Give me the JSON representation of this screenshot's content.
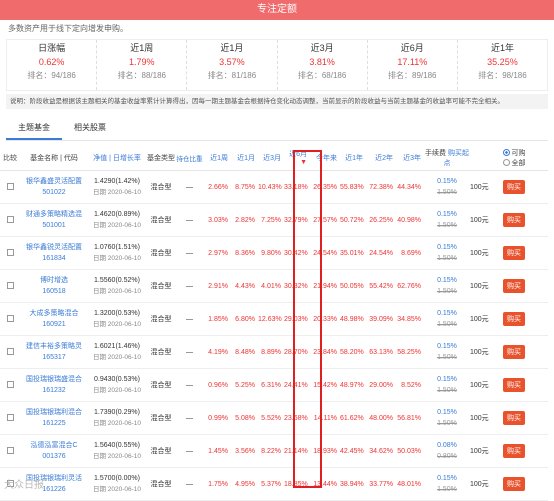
{
  "header": {
    "title": "专注定额"
  },
  "notice": "多数资产用于线下定向增发申购。",
  "stats": [
    {
      "label": "日涨幅",
      "pct": "0.62%",
      "rank": "排名：94/186"
    },
    {
      "label": "近1周",
      "pct": "1.79%",
      "rank": "排名：88/186"
    },
    {
      "label": "近1月",
      "pct": "3.57%",
      "rank": "排名：81/186"
    },
    {
      "label": "近3月",
      "pct": "3.81%",
      "rank": "排名：68/186"
    },
    {
      "label": "近6月",
      "pct": "17.11%",
      "rank": "排名：89/186"
    },
    {
      "label": "近1年",
      "pct": "35.25%",
      "rank": "排名：98/186"
    }
  ],
  "explain": "说明：阶段收益是根据该主题相关的基金收益率累计计算得出，因每一期主题基金会根据持仓变化动态调整，当前显示的阶段收益与当前主题基金的收益率可能不完全相关。",
  "tabs": [
    {
      "label": "主题基金"
    },
    {
      "label": "相关股票"
    }
  ],
  "columns": {
    "compare": "比较",
    "name": "基金名称 | 代码",
    "nav": "净值 | 日增长率",
    "type": "基金类型",
    "hold": "持仓比重",
    "w1": "近1周",
    "m1": "近1月",
    "m3": "近3月",
    "m6": "近6月",
    "ytd": "今年来",
    "y1": "近1年",
    "y2": "近2年",
    "y3": "近3年",
    "fee": "手续费",
    "buy": "购买起点",
    "opt1": "可购",
    "opt2": "全部"
  },
  "funds": [
    {
      "name": "银华鑫盛灵活配置",
      "code": "501022",
      "nav": "1.4290(1.42%)",
      "date": "日期 2020-06-10",
      "type": "混合型",
      "hold": "—",
      "w1": "2.66%",
      "m1": "8.75%",
      "m3": "10.43%",
      "m6": "33.18%",
      "ytd": "26.35%",
      "y1": "55.83%",
      "y2": "72.38%",
      "y3": "44.34%",
      "fee": "0.15%",
      "fee_old": "1.50%",
      "min": "100元",
      "buy": "购买"
    },
    {
      "name": "财通多策略精选混",
      "code": "501001",
      "nav": "1.4620(0.89%)",
      "date": "日期 2020-06-10",
      "type": "混合型",
      "hold": "—",
      "w1": "3.03%",
      "m1": "2.82%",
      "m3": "7.25%",
      "m6": "32.79%",
      "ytd": "27.57%",
      "y1": "50.72%",
      "y2": "26.25%",
      "y3": "40.98%",
      "fee": "0.15%",
      "fee_old": "1.50%",
      "min": "100元",
      "buy": "购买"
    },
    {
      "name": "银华鑫锐灵活配置",
      "code": "161834",
      "nav": "1.0760(1.51%)",
      "date": "日期 2020-06-10",
      "type": "混合型",
      "hold": "—",
      "w1": "2.97%",
      "m1": "8.36%",
      "m3": "9.80%",
      "m6": "30.42%",
      "ytd": "24.54%",
      "y1": "35.01%",
      "y2": "24.54%",
      "y3": "8.69%",
      "fee": "0.15%",
      "fee_old": "1.50%",
      "min": "100元",
      "buy": "购买"
    },
    {
      "name": "博时增选",
      "code": "160518",
      "nav": "1.5560(0.52%)",
      "date": "日期 2020-06-10",
      "type": "混合型",
      "hold": "—",
      "w1": "2.91%",
      "m1": "4.43%",
      "m3": "4.01%",
      "m6": "30.32%",
      "ytd": "21.94%",
      "y1": "50.05%",
      "y2": "55.42%",
      "y3": "62.76%",
      "fee": "0.15%",
      "fee_old": "1.50%",
      "min": "100元",
      "buy": "购买"
    },
    {
      "name": "大成多策略混合",
      "code": "160921",
      "nav": "1.3200(0.53%)",
      "date": "日期 2020-06-10",
      "type": "混合型",
      "hold": "—",
      "w1": "1.85%",
      "m1": "6.80%",
      "m3": "12.63%",
      "m6": "29.03%",
      "ytd": "20.33%",
      "y1": "48.98%",
      "y2": "39.09%",
      "y3": "34.85%",
      "fee": "0.15%",
      "fee_old": "1.50%",
      "min": "100元",
      "buy": "购买"
    },
    {
      "name": "建信丰裕多策略灵",
      "code": "165317",
      "nav": "1.6021(1.46%)",
      "date": "日期 2020-06-10",
      "type": "混合型",
      "hold": "—",
      "w1": "4.19%",
      "m1": "8.48%",
      "m3": "8.89%",
      "m6": "28.70%",
      "ytd": "23.84%",
      "y1": "58.20%",
      "y2": "63.13%",
      "y3": "58.25%",
      "fee": "0.15%",
      "fee_old": "1.50%",
      "min": "100元",
      "buy": "购买"
    },
    {
      "name": "国投瑞银瑞盛混合",
      "code": "161232",
      "nav": "0.9430(0.53%)",
      "date": "日期 2020-06-10",
      "type": "混合型",
      "hold": "—",
      "w1": "0.96%",
      "m1": "5.25%",
      "m3": "6.31%",
      "m6": "24.41%",
      "ytd": "15.42%",
      "y1": "48.97%",
      "y2": "29.00%",
      "y3": "8.52%",
      "fee": "0.15%",
      "fee_old": "1.50%",
      "min": "100元",
      "buy": "购买"
    },
    {
      "name": "国投瑞银瑞利混合",
      "code": "161225",
      "nav": "1.7390(0.29%)",
      "date": "日期 2020-06-10",
      "type": "混合型",
      "hold": "—",
      "w1": "0.99%",
      "m1": "5.08%",
      "m3": "5.52%",
      "m6": "23.68%",
      "ytd": "14.11%",
      "y1": "61.62%",
      "y2": "48.00%",
      "y3": "56.81%",
      "fee": "0.15%",
      "fee_old": "1.50%",
      "min": "100元",
      "buy": "购买"
    },
    {
      "name": "泓德泓富混合C",
      "code": "001376",
      "nav": "1.5640(0.55%)",
      "date": "日期 2020-06-10",
      "type": "混合型",
      "hold": "—",
      "w1": "1.45%",
      "m1": "3.56%",
      "m3": "8.22%",
      "m6": "21.14%",
      "ytd": "18.93%",
      "y1": "42.45%",
      "y2": "34.62%",
      "y3": "50.03%",
      "fee": "0.08%",
      "fee_old": "0.80%",
      "min": "100元",
      "buy": "购买"
    },
    {
      "name": "国投瑞银瑞利灵活",
      "code": "161226",
      "nav": "1.5700(0.00%)",
      "date": "日期 2020-06-10",
      "type": "混合型",
      "hold": "—",
      "w1": "1.75%",
      "m1": "4.95%",
      "m3": "5.37%",
      "m6": "18.85%",
      "ytd": "13.44%",
      "y1": "38.94%",
      "y2": "33.77%",
      "y3": "48.01%",
      "fee": "0.15%",
      "fee_old": "1.50%",
      "min": "100元",
      "buy": "购买"
    }
  ],
  "watermark": "大众日报"
}
